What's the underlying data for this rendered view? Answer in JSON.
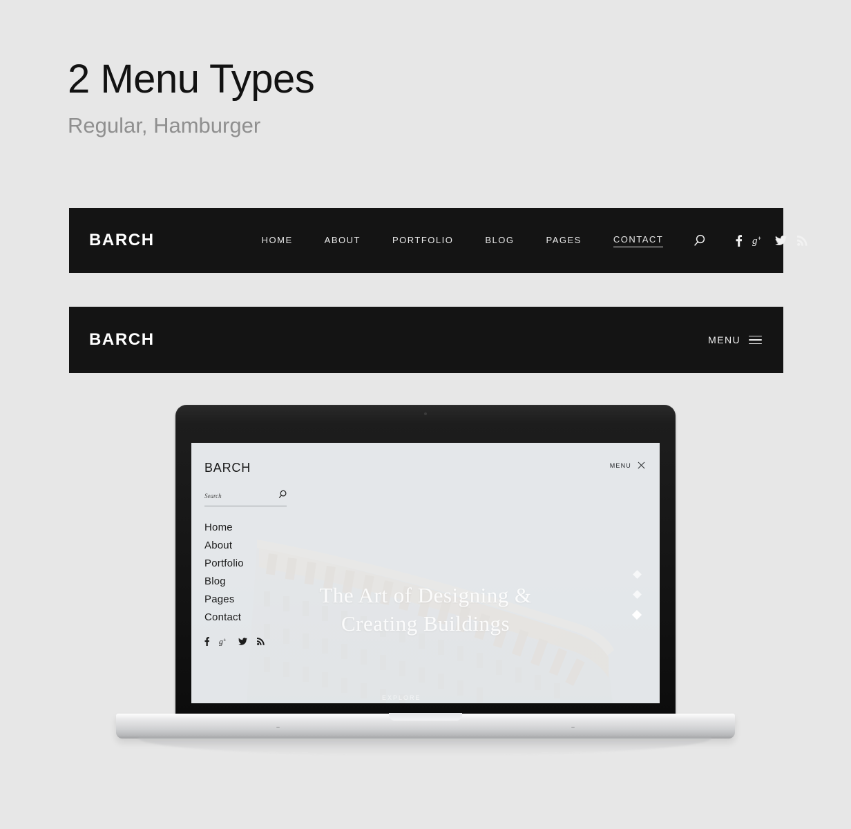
{
  "page": {
    "background_color": "#e7e7e7",
    "title": "2 Menu Types",
    "subtitle": "Regular, Hamburger"
  },
  "regular_menu": {
    "bar_color": "#141414",
    "logo": "BARCH",
    "items": [
      {
        "label": "HOME",
        "active": false
      },
      {
        "label": "ABOUT",
        "active": false
      },
      {
        "label": "PORTFOLIO",
        "active": false
      },
      {
        "label": "BLOG",
        "active": false
      },
      {
        "label": "PAGES",
        "active": false
      },
      {
        "label": "CONTACT",
        "active": true
      }
    ],
    "search_icon": "search-icon",
    "socials": [
      {
        "name": "facebook-icon",
        "label": "f"
      },
      {
        "name": "google-plus-icon",
        "label": "g+"
      },
      {
        "name": "twitter-icon",
        "label": "twitter"
      },
      {
        "name": "rss-icon",
        "label": "rss"
      }
    ]
  },
  "hamburger_menu": {
    "bar_color": "#141414",
    "logo": "BARCH",
    "menu_label": "MENU",
    "icon": "hamburger-icon"
  },
  "laptop_screen": {
    "background_color": "#e4e7ea",
    "logo": "BARCH",
    "menu_label": "MENU",
    "close_icon": "close-icon",
    "search": {
      "placeholder": "Search",
      "value": "",
      "icon": "search-icon"
    },
    "nav_items": [
      {
        "label": "Home"
      },
      {
        "label": "About"
      },
      {
        "label": "Portfolio"
      },
      {
        "label": "Blog"
      },
      {
        "label": "Pages"
      },
      {
        "label": "Contact"
      }
    ],
    "socials": [
      {
        "name": "facebook-icon",
        "label": "f"
      },
      {
        "name": "google-plus-icon",
        "label": "g+"
      },
      {
        "name": "twitter-icon",
        "label": "twitter"
      },
      {
        "name": "rss-icon",
        "label": "rss"
      }
    ],
    "hero": {
      "line1": "The Art of Designing &",
      "line2": "Creating Buildings",
      "explore_label": "EXPLORE",
      "slides": 3,
      "active_slide": 3
    }
  }
}
